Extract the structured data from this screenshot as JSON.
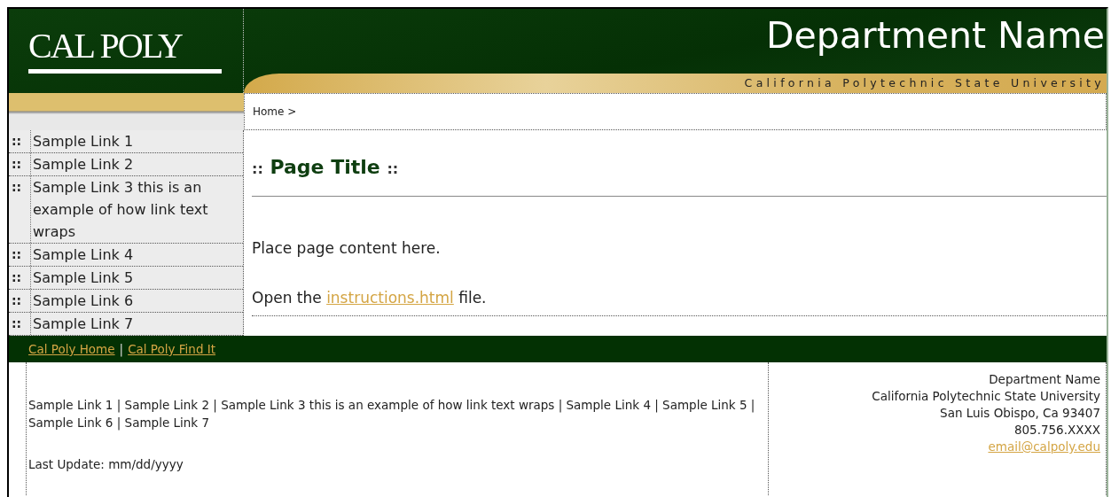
{
  "header": {
    "logo": "CAL POLY",
    "department": "Department Name",
    "university": "California Polytechnic State University"
  },
  "breadcrumb": "Home >",
  "sidebar": {
    "items": [
      {
        "marker": "::",
        "label": "Sample Link 1"
      },
      {
        "marker": "::",
        "label": "Sample Link 2"
      },
      {
        "marker": "::",
        "label": "Sample Link 3 this is an example of how link text wraps"
      },
      {
        "marker": "::",
        "label": "Sample Link 4"
      },
      {
        "marker": "::",
        "label": "Sample Link 5"
      },
      {
        "marker": "::",
        "label": "Sample Link 6"
      },
      {
        "marker": "::",
        "label": "Sample Link 7"
      }
    ]
  },
  "content": {
    "title_prefix": "::",
    "title": "Page Title",
    "title_suffix": "::",
    "paragraph": "Place page content here.",
    "open_before": "Open the",
    "open_link": "instructions.html",
    "open_after": "file."
  },
  "footer": {
    "links": [
      {
        "label": "Cal Poly Home"
      },
      {
        "label": "Cal Poly Find It"
      }
    ],
    "separator": "|",
    "sitemap": "Sample Link 1 | Sample Link 2 | Sample Link 3 this is an example of how link text wraps | Sample Link 4 | Sample Link 5 | Sample Link 6 | Sample Link 7",
    "last_update": "Last Update: mm/dd/yyyy",
    "address": [
      "Department Name",
      "California Polytechnic State University",
      "San Luis Obispo, Ca 93407",
      "805.756.XXXX"
    ],
    "email": "email@calpoly.edu"
  }
}
